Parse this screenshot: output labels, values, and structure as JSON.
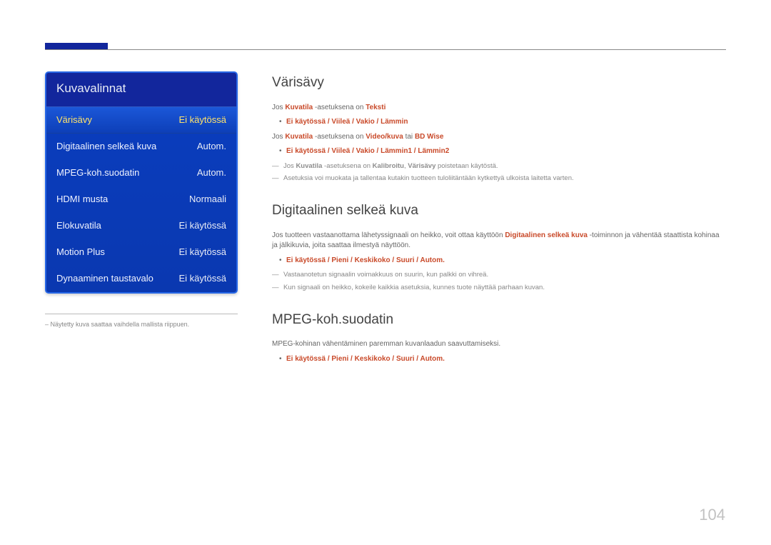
{
  "menu": {
    "title": "Kuvavalinnat",
    "items": [
      {
        "label": "Värisävy",
        "value": "Ei käytössä",
        "selected": true
      },
      {
        "label": "Digitaalinen selkeä kuva",
        "value": "Autom.",
        "selected": false
      },
      {
        "label": "MPEG-koh.suodatin",
        "value": "Autom.",
        "selected": false
      },
      {
        "label": "HDMI musta",
        "value": "Normaali",
        "selected": false
      },
      {
        "label": "Elokuvatila",
        "value": "Ei käytössä",
        "selected": false
      },
      {
        "label": "Motion Plus",
        "value": "Ei käytössä",
        "selected": false
      },
      {
        "label": "Dynaaminen taustavalo",
        "value": "Ei käytössä",
        "selected": false
      }
    ]
  },
  "footnote": "Näytetty kuva saattaa vaihdella mallista riippuen.",
  "sections": {
    "s1": {
      "heading": "Värisävy",
      "p1_pre": "Jos ",
      "p1_kw1": "Kuvatila",
      "p1_mid": " -asetuksena on ",
      "p1_kw2": "Teksti",
      "li1": "Ei käytössä / Viileä / Vakio / Lämmin",
      "p2_pre": "Jos ",
      "p2_kw1": "Kuvatila",
      "p2_mid": " -asetuksena on ",
      "p2_kw2": "Video/kuva",
      "p2_mid2": " tai ",
      "p2_kw3": "BD Wise",
      "li2": "Ei käytössä / Viileä / Vakio / Lämmin1 / Lämmin2",
      "d1_pre": "Jos ",
      "d1_kw1": "Kuvatila",
      "d1_mid": " -asetuksena on ",
      "d1_kw2": "Kalibroitu",
      "d1_sep": ", ",
      "d1_kw3": "Värisävy",
      "d1_post": " poistetaan käytöstä.",
      "d2": "Asetuksia voi muokata ja tallentaa kutakin tuotteen tuloliitäntään kytkettyä ulkoista laitetta varten."
    },
    "s2": {
      "heading": "Digitaalinen selkeä kuva",
      "p1_pre": "Jos tuotteen vastaanottama lähetyssignaali on heikko, voit ottaa käyttöön ",
      "p1_kw1": "Digitaalinen selkeä kuva",
      "p1_post": " -toiminnon ja vähentää staattista kohinaa ja jälkikuvia, joita saattaa ilmestyä näyttöön.",
      "li1": "Ei käytössä / Pieni / Keskikoko / Suuri / Autom.",
      "d1": "Vastaanotetun signaalin voimakkuus on suurin, kun palkki on vihreä.",
      "d2": "Kun signaali on heikko, kokeile kaikkia asetuksia, kunnes tuote näyttää parhaan kuvan."
    },
    "s3": {
      "heading": "MPEG-koh.suodatin",
      "p1": "MPEG-kohinan vähentäminen paremman kuvanlaadun saavuttamiseksi.",
      "li1": "Ei käytössä / Pieni / Keskikoko / Suuri / Autom."
    }
  },
  "page_number": "104"
}
